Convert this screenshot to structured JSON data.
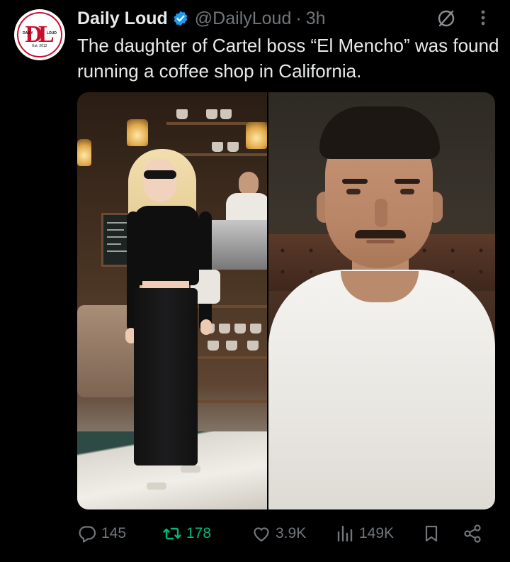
{
  "account": {
    "name": "Daily Loud",
    "handle": "@DailyLoud",
    "separator": "·",
    "time": "3h",
    "logo_text": {
      "left": "DAILY",
      "right": "LOUD",
      "est": "Est. 2012"
    }
  },
  "post": {
    "text": "The daughter of Cartel boss “El Mencho” was found running a coffee shop in California."
  },
  "metrics": {
    "replies": "145",
    "reposts": "178",
    "likes": "3.9K",
    "views": "149K"
  },
  "colors": {
    "background": "#000000",
    "text": "#e7e9ea",
    "secondary": "#71767b",
    "verified": "#1d9bf0",
    "repost_active": "#00ba7c",
    "brand_red": "#c8102e"
  },
  "icons": {
    "verified": "verified-badge-icon",
    "grok": "grok-icon",
    "more": "more-icon",
    "reply": "reply-icon",
    "repost": "repost-icon",
    "like": "heart-icon",
    "views": "views-icon",
    "bookmark": "bookmark-icon",
    "share": "share-icon"
  }
}
